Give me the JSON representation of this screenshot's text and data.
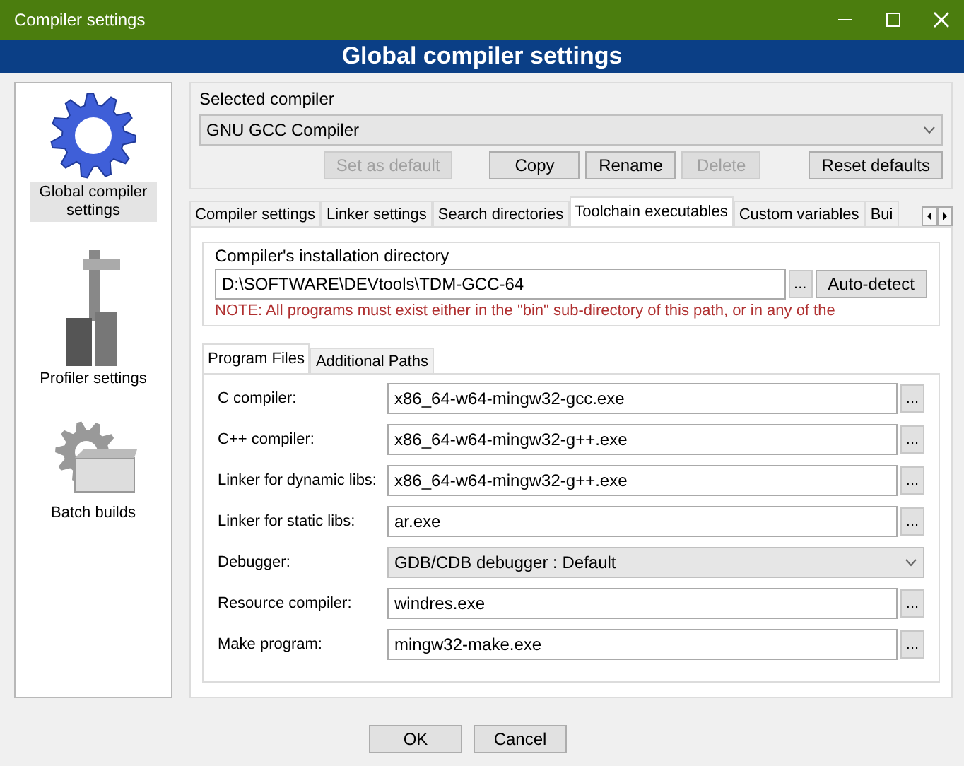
{
  "window": {
    "title": "Compiler settings"
  },
  "header": {
    "title": "Global compiler settings"
  },
  "sidebar": {
    "items": [
      {
        "label": "Global compiler settings",
        "kind": "gear",
        "selected": true
      },
      {
        "label": "Profiler settings",
        "kind": "caliper",
        "selected": false
      },
      {
        "label": "Batch builds",
        "kind": "batch",
        "selected": false
      }
    ]
  },
  "selected_compiler": {
    "label": "Selected compiler",
    "value": "GNU GCC Compiler",
    "buttons": [
      {
        "label": "Set as default",
        "disabled": true
      },
      {
        "label": "Copy",
        "disabled": false
      },
      {
        "label": "Rename",
        "disabled": false
      },
      {
        "label": "Delete",
        "disabled": true
      },
      {
        "label": "Reset defaults",
        "disabled": false
      }
    ]
  },
  "tabs": [
    {
      "label": "Compiler settings",
      "selected": false
    },
    {
      "label": "Linker settings",
      "selected": false
    },
    {
      "label": "Search directories",
      "selected": false
    },
    {
      "label": "Toolchain executables",
      "selected": true
    },
    {
      "label": "Custom variables",
      "selected": false
    },
    {
      "label": "Bui",
      "selected": false
    }
  ],
  "install_dir": {
    "label": "Compiler's installation directory",
    "value": "D:\\SOFTWARE\\DEVtools\\TDM-GCC-64",
    "browse": "...",
    "autodetect": "Auto-detect",
    "note": "NOTE: All programs must exist either in the \"bin\" sub-directory of this path, or in any of the"
  },
  "inner_tabs": [
    {
      "label": "Program Files",
      "selected": true
    },
    {
      "label": "Additional Paths",
      "selected": false
    }
  ],
  "fields": [
    {
      "label": "C compiler:",
      "kind": "text",
      "value": "x86_64-w64-mingw32-gcc.exe",
      "browse": "..."
    },
    {
      "label": "C++ compiler:",
      "kind": "text",
      "value": "x86_64-w64-mingw32-g++.exe",
      "browse": "..."
    },
    {
      "label": "Linker for dynamic libs:",
      "kind": "text",
      "value": "x86_64-w64-mingw32-g++.exe",
      "browse": "..."
    },
    {
      "label": "Linker for static libs:",
      "kind": "text",
      "value": "ar.exe",
      "browse": "..."
    },
    {
      "label": "Debugger:",
      "kind": "select",
      "value": "GDB/CDB debugger : Default"
    },
    {
      "label": "Resource compiler:",
      "kind": "text",
      "value": "windres.exe",
      "browse": "..."
    },
    {
      "label": "Make program:",
      "kind": "text",
      "value": "mingw32-make.exe",
      "browse": "..."
    }
  ],
  "buttons": [
    {
      "label": "OK"
    },
    {
      "label": "Cancel"
    }
  ]
}
